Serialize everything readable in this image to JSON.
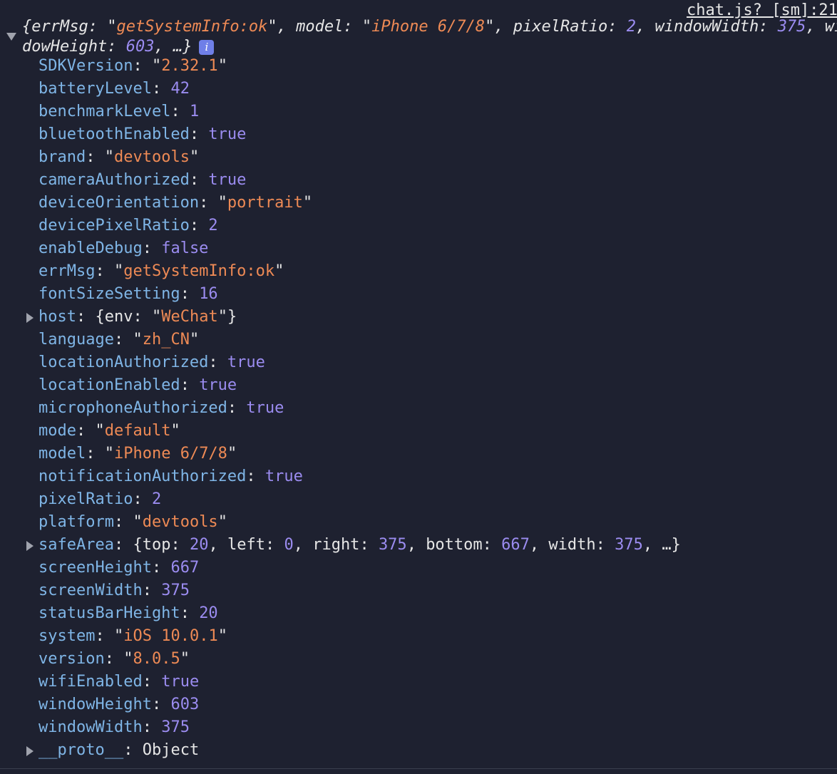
{
  "source": "chat.js? [sm]:21",
  "summary": {
    "line1": "{errMsg: \"getSystemInfo:ok\", model: \"iPhone 6/7/8\", pixelRatio: 2, windowWidth: 375, wi",
    "line2": "dowHeight: 603, …}",
    "info_icon": "i"
  },
  "properties": [
    {
      "key": "SDKVersion",
      "type": "string",
      "value": "2.32.1"
    },
    {
      "key": "batteryLevel",
      "type": "number",
      "value": "42"
    },
    {
      "key": "benchmarkLevel",
      "type": "number",
      "value": "1"
    },
    {
      "key": "bluetoothEnabled",
      "type": "boolean",
      "value": "true"
    },
    {
      "key": "brand",
      "type": "string",
      "value": "devtools"
    },
    {
      "key": "cameraAuthorized",
      "type": "boolean",
      "value": "true"
    },
    {
      "key": "deviceOrientation",
      "type": "string",
      "value": "portrait"
    },
    {
      "key": "devicePixelRatio",
      "type": "number",
      "value": "2"
    },
    {
      "key": "enableDebug",
      "type": "boolean",
      "value": "false"
    },
    {
      "key": "errMsg",
      "type": "string",
      "value": "getSystemInfo:ok"
    },
    {
      "key": "fontSizeSetting",
      "type": "number",
      "value": "16"
    },
    {
      "key": "host",
      "type": "object",
      "expandable": true,
      "fields": [
        {
          "k": "env",
          "v": "WeChat",
          "t": "string"
        }
      ],
      "more": false
    },
    {
      "key": "language",
      "type": "string",
      "value": "zh_CN"
    },
    {
      "key": "locationAuthorized",
      "type": "boolean",
      "value": "true"
    },
    {
      "key": "locationEnabled",
      "type": "boolean",
      "value": "true"
    },
    {
      "key": "microphoneAuthorized",
      "type": "boolean",
      "value": "true"
    },
    {
      "key": "mode",
      "type": "string",
      "value": "default"
    },
    {
      "key": "model",
      "type": "string",
      "value": "iPhone 6/7/8"
    },
    {
      "key": "notificationAuthorized",
      "type": "boolean",
      "value": "true"
    },
    {
      "key": "pixelRatio",
      "type": "number",
      "value": "2"
    },
    {
      "key": "platform",
      "type": "string",
      "value": "devtools"
    },
    {
      "key": "safeArea",
      "type": "object",
      "expandable": true,
      "fields": [
        {
          "k": "top",
          "v": "20",
          "t": "number"
        },
        {
          "k": "left",
          "v": "0",
          "t": "number"
        },
        {
          "k": "right",
          "v": "375",
          "t": "number"
        },
        {
          "k": "bottom",
          "v": "667",
          "t": "number"
        },
        {
          "k": "width",
          "v": "375",
          "t": "number"
        }
      ],
      "more": true
    },
    {
      "key": "screenHeight",
      "type": "number",
      "value": "667"
    },
    {
      "key": "screenWidth",
      "type": "number",
      "value": "375"
    },
    {
      "key": "statusBarHeight",
      "type": "number",
      "value": "20"
    },
    {
      "key": "system",
      "type": "string",
      "value": "iOS 10.0.1"
    },
    {
      "key": "version",
      "type": "string",
      "value": "8.0.5"
    },
    {
      "key": "wifiEnabled",
      "type": "boolean",
      "value": "true"
    },
    {
      "key": "windowHeight",
      "type": "number",
      "value": "603"
    },
    {
      "key": "windowWidth",
      "type": "number",
      "value": "375"
    },
    {
      "key": "__proto__",
      "type": "proto",
      "expandable": true,
      "value": "Object"
    }
  ],
  "colors": {
    "background": "#1e2130",
    "key": "#7fb5e6",
    "string": "#ee8a55",
    "number": "#9b8cf0",
    "punctuation": "#e6e6e6"
  }
}
